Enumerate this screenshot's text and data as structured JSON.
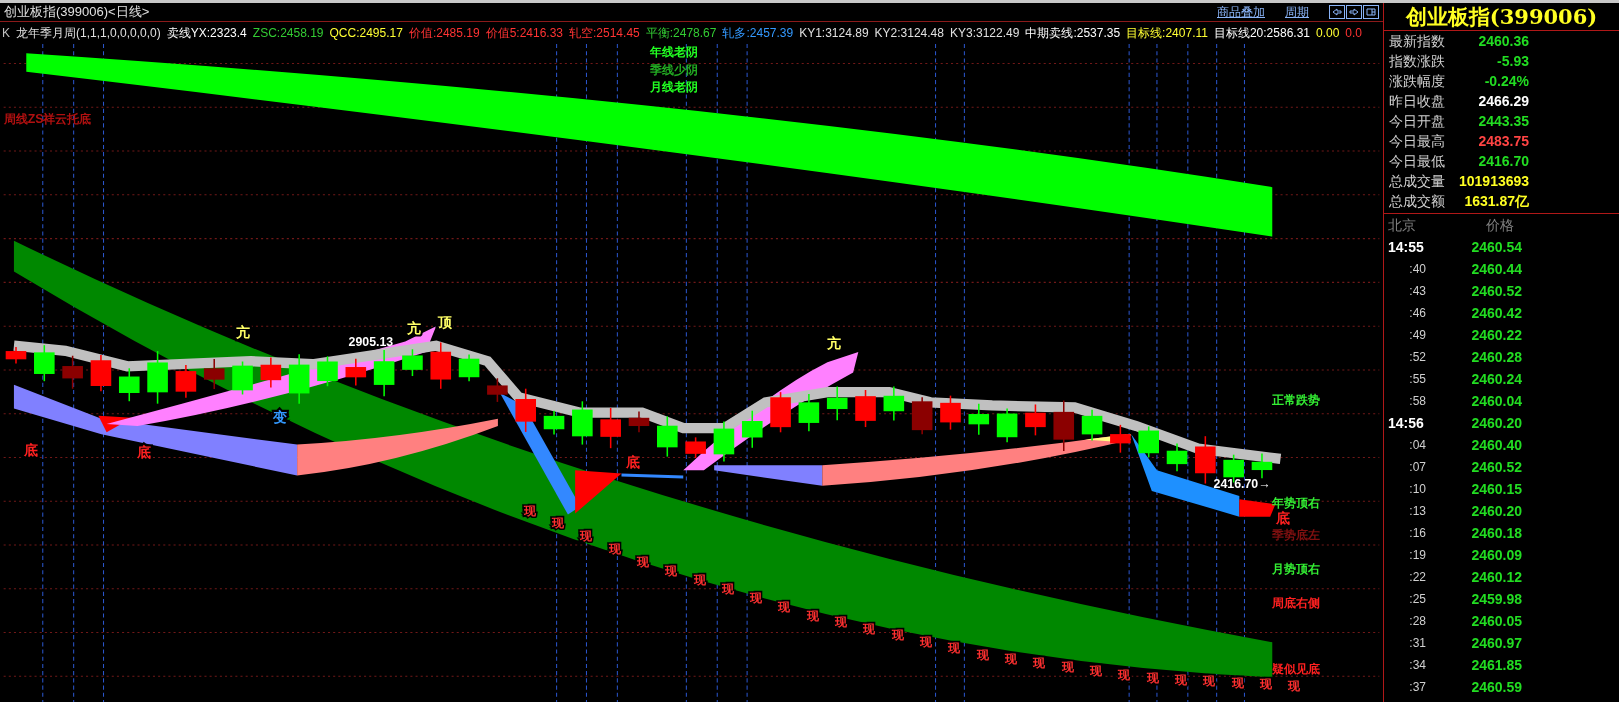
{
  "header": {
    "title": "创业板指(399006)<日线>",
    "buttons": [
      "商品叠加",
      "周期"
    ]
  },
  "legend": [
    {
      "text": "K",
      "color": "#c0c0c0"
    },
    {
      "text": "龙年季月周(1,1,1,0,0,0,0,0)",
      "color": "#e0e0e0"
    },
    {
      "text": "卖线YX:2323.4",
      "color": "#ffffff"
    },
    {
      "text": "ZSC:2458.19",
      "color": "#33cc33"
    },
    {
      "text": "QCC:2495.17",
      "color": "#ffff33"
    },
    {
      "text": "价值:2485.19",
      "color": "#ff3333"
    },
    {
      "text": "价值5:2416.33",
      "color": "#ff3333"
    },
    {
      "text": "轧空:2514.45",
      "color": "#ff3333"
    },
    {
      "text": "平衡:2478.67",
      "color": "#33cc33"
    },
    {
      "text": "轧多:2457.39",
      "color": "#3399ff"
    },
    {
      "text": "KY1:3124.89",
      "color": "#e0e0e0"
    },
    {
      "text": "KY2:3124.48",
      "color": "#e0e0e0"
    },
    {
      "text": "KY3:3122.49",
      "color": "#e0e0e0"
    },
    {
      "text": "中期卖线:2537.35",
      "color": "#ffffff"
    },
    {
      "text": "目标线:2407.11",
      "color": "#ffff33"
    },
    {
      "text": "目标线20:2586.31",
      "color": "#ffffff"
    },
    {
      "text": "0.00",
      "color": "#ffff33"
    },
    {
      "text": "0.0",
      "color": "#ff3333"
    }
  ],
  "chart": {
    "top_labels": [
      {
        "text": "年线老阴",
        "color": "#22ff22"
      },
      {
        "text": "季线少阴",
        "color": "#22aa22"
      },
      {
        "text": "月线老阴",
        "color": "#22ff22"
      }
    ],
    "left_label": {
      "text": "周线ZS祥云托底",
      "color": "#b01010"
    },
    "high_price": "2905.13",
    "low_price": "2416.70→",
    "right_labels": [
      {
        "text": "正常跌势",
        "color": "#33ee33"
      },
      {
        "text": "年势顶右",
        "color": "#33ee33"
      },
      {
        "text": "季势底左",
        "color": "#801010"
      },
      {
        "text": "月势顶右",
        "color": "#33ee33"
      },
      {
        "text": "周底右侧",
        "color": "#ff2020"
      },
      {
        "text": "疑似见底",
        "color": "#ff2020"
      }
    ],
    "signals": [
      {
        "text": "底",
        "color": "#ff2020"
      },
      {
        "text": "底",
        "color": "#ff2020"
      },
      {
        "text": "亢",
        "color": "#ffff66"
      },
      {
        "text": "变",
        "color": "#3399ff"
      },
      {
        "text": "亢",
        "color": "#ffff66"
      },
      {
        "text": "顶",
        "color": "#ffff66"
      },
      {
        "text": "底",
        "color": "#ff2020"
      },
      {
        "text": "亢",
        "color": "#ffff66"
      },
      {
        "text": "底",
        "color": "#ff2020"
      }
    ],
    "xian_marks": [
      "现",
      "现",
      "现",
      "现",
      "现",
      "现",
      "现",
      "现",
      "现",
      "现",
      "现",
      "现",
      "现",
      "现",
      "现",
      "现",
      "现",
      "现",
      "现",
      "现",
      "现",
      "现",
      "现",
      "现",
      "现",
      "现",
      "现",
      "现"
    ]
  },
  "quote": {
    "title": "创业板指(399006)",
    "stats": [
      {
        "label": "最新指数",
        "value": "2460.36",
        "color": "#22dd22"
      },
      {
        "label": "指数涨跌",
        "value": "-5.93",
        "color": "#22dd22"
      },
      {
        "label": "涨跌幅度",
        "value": "-0.24%",
        "color": "#22dd22"
      },
      {
        "label": "昨日收盘",
        "value": "2466.29",
        "color": "#ffffff"
      },
      {
        "label": "今日开盘",
        "value": "2443.35",
        "color": "#22dd22"
      },
      {
        "label": "今日最高",
        "value": "2483.75",
        "color": "#ff4444"
      },
      {
        "label": "今日最低",
        "value": "2416.70",
        "color": "#22dd22"
      },
      {
        "label": "总成交量",
        "value": "101913693",
        "color": "#ffff22"
      },
      {
        "label": "总成交额",
        "value": "1631.87亿",
        "color": "#ffff22"
      }
    ],
    "ticks_header": {
      "time": "北京",
      "price": "价格"
    },
    "ticks": [
      {
        "time": "14:55",
        "price": "2460.54",
        "kind": "hour"
      },
      {
        "time": ":40",
        "price": "2460.44",
        "kind": "second"
      },
      {
        "time": ":43",
        "price": "2460.52",
        "kind": "second"
      },
      {
        "time": ":46",
        "price": "2460.42",
        "kind": "second"
      },
      {
        "time": ":49",
        "price": "2460.22",
        "kind": "second"
      },
      {
        "time": ":52",
        "price": "2460.28",
        "kind": "second"
      },
      {
        "time": ":55",
        "price": "2460.24",
        "kind": "second"
      },
      {
        "time": ":58",
        "price": "2460.04",
        "kind": "second"
      },
      {
        "time": "14:56",
        "price": "2460.20",
        "kind": "hour"
      },
      {
        "time": ":04",
        "price": "2460.40",
        "kind": "second"
      },
      {
        "time": ":07",
        "price": "2460.52",
        "kind": "second"
      },
      {
        "time": ":10",
        "price": "2460.15",
        "kind": "second"
      },
      {
        "time": ":13",
        "price": "2460.20",
        "kind": "second"
      },
      {
        "time": ":16",
        "price": "2460.18",
        "kind": "second"
      },
      {
        "time": ":19",
        "price": "2460.09",
        "kind": "second"
      },
      {
        "time": ":22",
        "price": "2460.12",
        "kind": "second"
      },
      {
        "time": ":25",
        "price": "2459.98",
        "kind": "second"
      },
      {
        "time": ":28",
        "price": "2460.05",
        "kind": "second"
      },
      {
        "time": ":31",
        "price": "2460.97",
        "kind": "second"
      },
      {
        "time": ":34",
        "price": "2461.85",
        "kind": "second"
      },
      {
        "time": ":37",
        "price": "2460.59",
        "kind": "second"
      }
    ]
  }
}
